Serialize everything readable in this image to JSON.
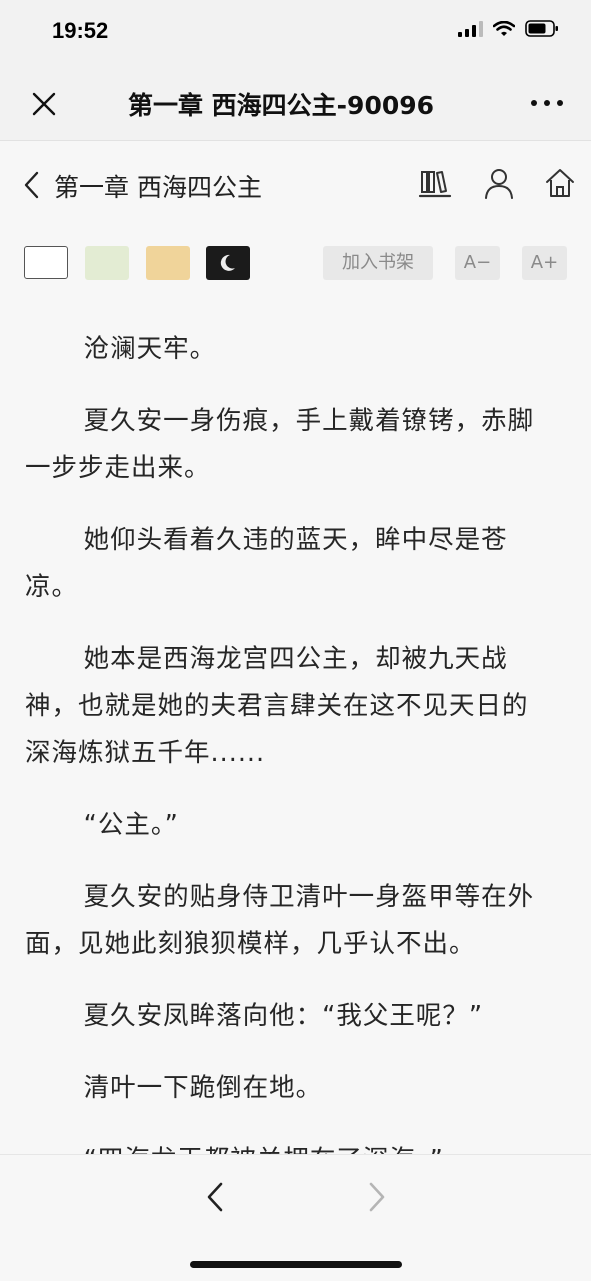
{
  "status_bar": {
    "time": "19:52"
  },
  "wechat_bar": {
    "title": "第一章 西海四公主-90096"
  },
  "header": {
    "chapter_title": "第一章 西海四公主"
  },
  "toolbar": {
    "themes": [
      {
        "name": "white",
        "color": "#ffffff"
      },
      {
        "name": "green",
        "color": "#e3ecd3"
      },
      {
        "name": "yellow",
        "color": "#f0d49a"
      },
      {
        "name": "dark",
        "color": "#1b1b1b"
      }
    ],
    "add_shelf_label": "加入书架",
    "font_smaller_label": "A−",
    "font_larger_label": "A+"
  },
  "content": {
    "paragraphs": [
      "沧澜天牢。",
      "夏久安一身伤痕，手上戴着镣铐，赤脚一步步走出来。",
      "她仰头看着久违的蓝天，眸中尽是苍凉。",
      "她本是西海龙宫四公主，却被九天战神，也就是她的夫君言肆关在这不见天日的深海炼狱五千年......",
      "“公主。”",
      "夏久安的贴身侍卫清叶一身盔甲等在外面，见她此刻狼狈模样，几乎认不出。",
      "夏久安凤眸落向他：“我父王呢？”",
      "清叶一下跪倒在地。",
      "“四海龙王都被关押在了深海。”"
    ]
  }
}
